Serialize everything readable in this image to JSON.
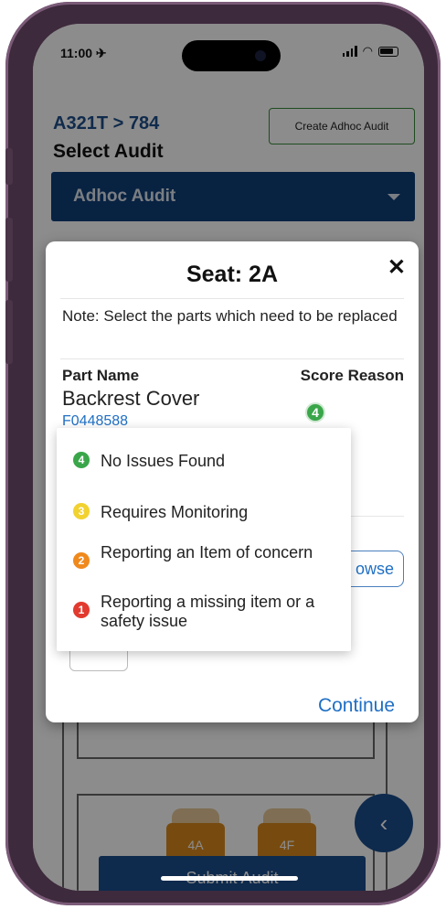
{
  "status_bar": {
    "time": "11:00 ✈︎"
  },
  "header": {
    "breadcrumb": "A321T > 784",
    "title": "Select Audit",
    "create_adhoc_label": "Create Adhoc Audit"
  },
  "audit_select": {
    "selected": "Adhoc Audit"
  },
  "seats": [
    {
      "label": "4A"
    },
    {
      "label": "4F"
    }
  ],
  "submit_label": "Submit Audit",
  "modal": {
    "title": "Seat: 2A",
    "note": "Note: Select the parts which need to be replaced",
    "col_part": "Part Name",
    "col_score": "Score Reason",
    "part": {
      "name": "Backrest Cover",
      "number": "F0448588",
      "score": "4"
    },
    "browse_label": "owse",
    "continue_label": "Continue"
  },
  "score_options": [
    {
      "score": "4",
      "label": "No Issues Found",
      "color": "#3aa64a"
    },
    {
      "score": "3",
      "label": "Requires Monitoring",
      "color": "#f2d230"
    },
    {
      "score": "2",
      "label": "Reporting an Item of concern",
      "color": "#f0891c"
    },
    {
      "score": "1",
      "label": "Reporting a missing item or a safety issue",
      "color": "#e23a2e"
    }
  ]
}
